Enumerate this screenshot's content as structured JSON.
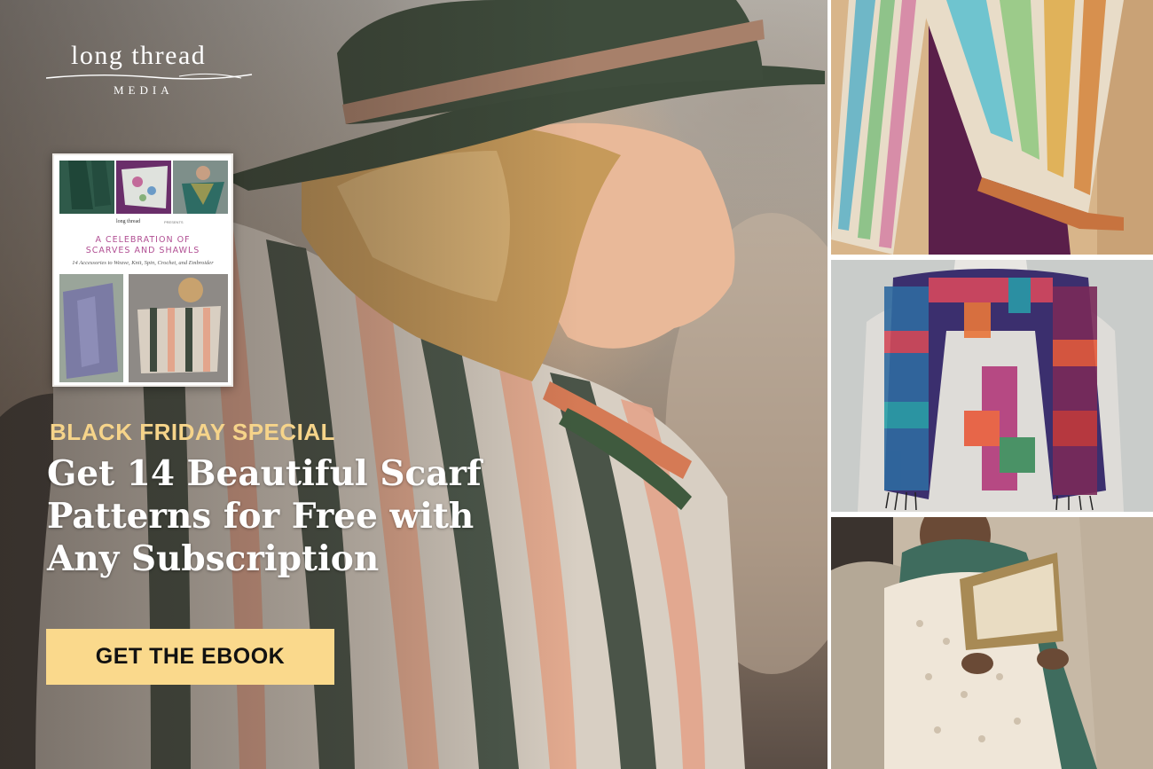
{
  "brand": {
    "logo_main": "long thread",
    "logo_sub": "MEDIA"
  },
  "ebook_cover": {
    "logo": "long thread",
    "presents": "PRESENTS",
    "title_line1": "A CELEBRATION OF",
    "title_line2": "SCARVES AND SHAWLS",
    "subtitle": "14 Accessories to Weave, Knit, Spin, Crochet, and Embroider"
  },
  "promo": {
    "eyebrow": "BLACK FRIDAY SPECIAL",
    "headline_line1": "Get 14 Beautiful Scarf",
    "headline_line2": "Patterns for Free with",
    "headline_line3": "Any Subscription",
    "cta_label": "GET THE EBOOK"
  },
  "colors": {
    "eyebrow": "#f6d48a",
    "cta_background": "#fad98c",
    "headline": "#ffffff"
  },
  "photos": {
    "hero": "woman-in-hat-wearing-striped-woven-scarf",
    "side_top": "knitted-striped-shawl-on-hanger",
    "side_middle": "woven-plaid-scarf-on-mannequin",
    "side_bottom": "woman-in-lace-shawl-reading-book"
  }
}
